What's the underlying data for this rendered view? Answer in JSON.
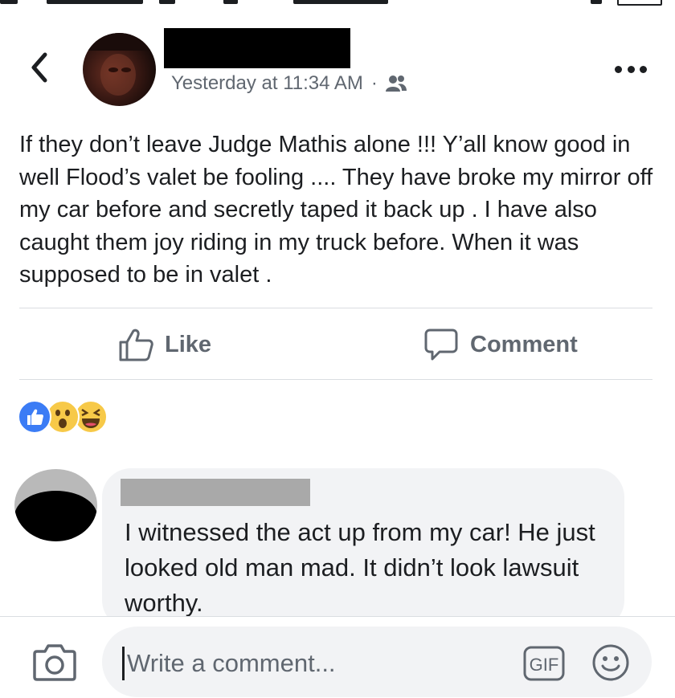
{
  "post": {
    "timestamp": "Yesterday at 11:34 AM",
    "separator": "·",
    "audience_icon": "friends-icon",
    "body": "If they don’t leave Judge Mathis alone !!! Y’all know good in well Flood’s valet be fooling .... They have broke my mirror off my car before and secretly taped it back up . I have also caught them joy riding in my truck before. When it was supposed to be in valet .",
    "actions": {
      "like_label": "Like",
      "comment_label": "Comment"
    },
    "reactions": [
      "like-reaction-icon",
      "wow-reaction-icon",
      "haha-reaction-icon"
    ]
  },
  "comment": {
    "text": "I witnessed the act up from my car! He just looked old man mad. It didn’t look lawsuit worthy."
  },
  "composer": {
    "placeholder": "Write a comment...",
    "gif_label": "GIF"
  },
  "colors": {
    "secondary_text": "#606770",
    "primary_text": "#1c1e21",
    "bubble_bg": "#f2f3f5",
    "like_blue": "#3b7cf5",
    "reaction_yellow": "#f7c948"
  }
}
